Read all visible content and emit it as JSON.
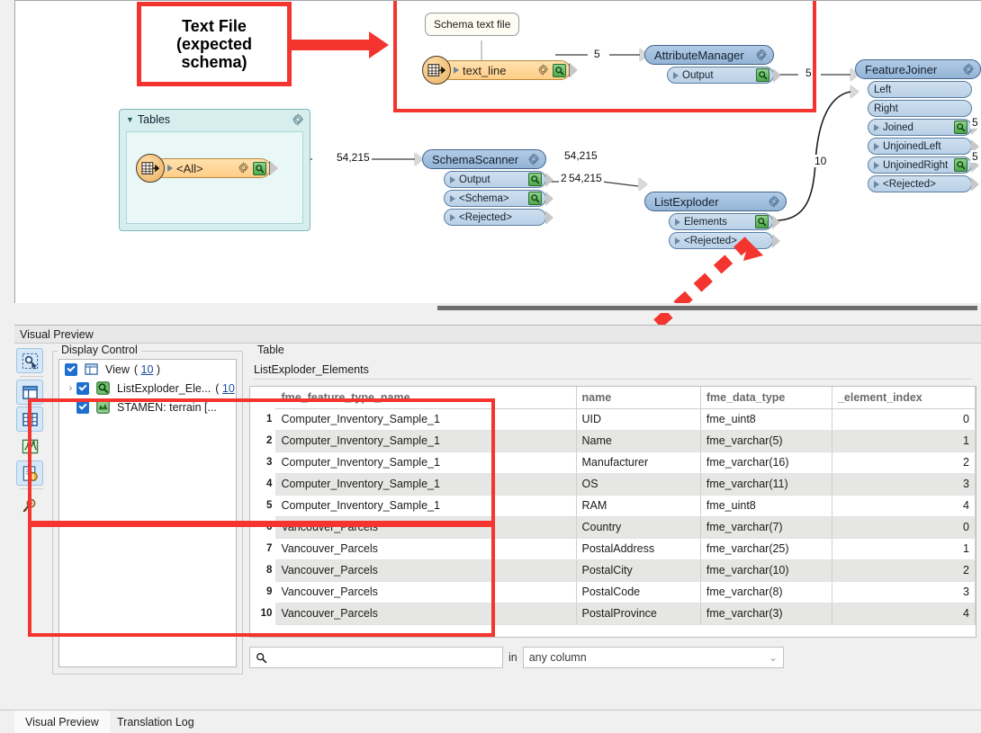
{
  "canvas": {
    "annotation": {
      "label": "Text File\n(expected\nschema)",
      "line1": "Text File",
      "line2": "(expected",
      "line3": "schema)",
      "color": "#f4352f"
    },
    "callout_schema_text_file": "Schema text file",
    "bookmark": {
      "title": "Tables",
      "feature_type": "<All>"
    },
    "nodes": [
      {
        "name": "text_line",
        "type": "reader"
      },
      {
        "name": "AttributeManager",
        "ports": [
          "Output"
        ]
      },
      {
        "name": "SchemaScanner",
        "ports": [
          "Output",
          "<Schema>",
          "<Rejected>"
        ]
      },
      {
        "name": "ListExploder",
        "ports": [
          "Elements",
          "<Rejected>"
        ]
      },
      {
        "name": "FeatureJoiner",
        "ports": [
          "Left",
          "Right",
          "Joined",
          "UnjoinedLeft",
          "UnjoinedRight",
          "<Rejected>"
        ]
      }
    ],
    "edge_labels": {
      "tables_to_schemascanner": "54,215",
      "schemascanner_output": "54,215",
      "schema_to_listexploder": "2",
      "textline_to_attributemanager": "5",
      "attributemanager_to_left": "5",
      "elements_to_right": "10",
      "joined_count": "5",
      "unjoinedright_count": "5"
    }
  },
  "preview": {
    "title": "Visual Preview",
    "tool_rail": [
      "select-tool-icon",
      "layout-panel-icon",
      "table-view-icon",
      "graphics-view-icon",
      "feature-info-icon",
      "inspect-tool-icon"
    ],
    "display_control": {
      "title": "Display Control",
      "tree": [
        {
          "label": "View",
          "count": "10",
          "checked": true,
          "icon": "view-icon",
          "indent": 0,
          "expander": ""
        },
        {
          "label": "ListExploder_Ele...",
          "count": "10",
          "checked": true,
          "icon": "inspector-icon",
          "indent": 1,
          "expander": "›"
        },
        {
          "label": "STAMEN: terrain [...",
          "count": "",
          "checked": true,
          "icon": "map-layer-icon",
          "indent": 1,
          "expander": ""
        }
      ]
    },
    "table": {
      "group_title": "Table",
      "name": "ListExploder_Elements",
      "columns": [
        "fme_feature_type_name",
        "name",
        "fme_data_type",
        "_element_index"
      ],
      "rows": [
        {
          "n": "1",
          "fme_feature_type_name": "Computer_Inventory_Sample_1",
          "name": "UID",
          "fme_data_type": "fme_uint8",
          "_element_index": "0"
        },
        {
          "n": "2",
          "fme_feature_type_name": "Computer_Inventory_Sample_1",
          "name": "Name",
          "fme_data_type": "fme_varchar(5)",
          "_element_index": "1"
        },
        {
          "n": "3",
          "fme_feature_type_name": "Computer_Inventory_Sample_1",
          "name": "Manufacturer",
          "fme_data_type": "fme_varchar(16)",
          "_element_index": "2"
        },
        {
          "n": "4",
          "fme_feature_type_name": "Computer_Inventory_Sample_1",
          "name": "OS",
          "fme_data_type": "fme_varchar(11)",
          "_element_index": "3"
        },
        {
          "n": "5",
          "fme_feature_type_name": "Computer_Inventory_Sample_1",
          "name": "RAM",
          "fme_data_type": "fme_uint8",
          "_element_index": "4"
        },
        {
          "n": "6",
          "fme_feature_type_name": "Vancouver_Parcels",
          "name": "Country",
          "fme_data_type": "fme_varchar(7)",
          "_element_index": "0"
        },
        {
          "n": "7",
          "fme_feature_type_name": "Vancouver_Parcels",
          "name": "PostalAddress",
          "fme_data_type": "fme_varchar(25)",
          "_element_index": "1"
        },
        {
          "n": "8",
          "fme_feature_type_name": "Vancouver_Parcels",
          "name": "PostalCity",
          "fme_data_type": "fme_varchar(10)",
          "_element_index": "2"
        },
        {
          "n": "9",
          "fme_feature_type_name": "Vancouver_Parcels",
          "name": "PostalCode",
          "fme_data_type": "fme_varchar(8)",
          "_element_index": "3"
        },
        {
          "n": "10",
          "fme_feature_type_name": "Vancouver_Parcels",
          "name": "PostalProvince",
          "fme_data_type": "fme_varchar(3)",
          "_element_index": "4"
        }
      ]
    },
    "search": {
      "value": "",
      "placeholder": "",
      "in_label": "in",
      "column_filter": "any column"
    }
  },
  "bottom_tabs": [
    {
      "label": "Visual Preview",
      "active": true
    },
    {
      "label": "Translation Log",
      "active": false
    }
  ]
}
